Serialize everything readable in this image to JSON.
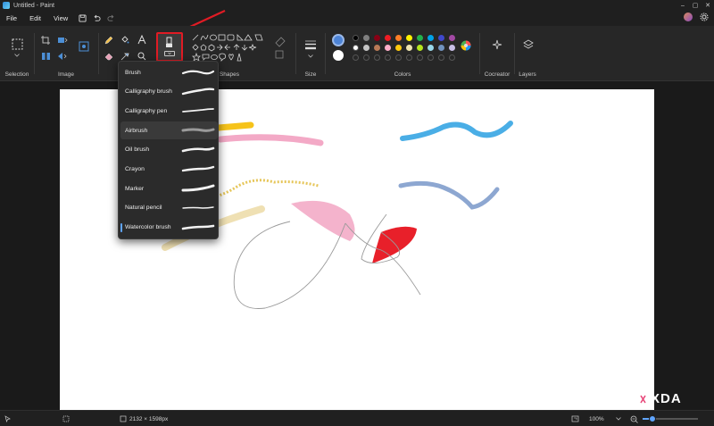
{
  "window": {
    "title": "Untitled - Paint",
    "controls": [
      "–",
      "▢",
      "✕"
    ]
  },
  "menu": {
    "items": [
      "File",
      "Edit",
      "View"
    ]
  },
  "ribbon": {
    "groups": {
      "selection": "Selection",
      "image": "Image",
      "shapes": "Shapes",
      "size": "Size",
      "colors": "Colors",
      "cocreator": "Cocreator",
      "layers": "Layers"
    },
    "primary_color": "#4c83d6",
    "secondary_color": "#ffffff",
    "palette_row1": [
      "#000000",
      "#7f7f7f",
      "#880015",
      "#ed1c24",
      "#ff7f27",
      "#fff200",
      "#22b14c",
      "#00a2e8",
      "#3f48cc",
      "#a349a4"
    ],
    "palette_row2": [
      "#ffffff",
      "#c3c3c3",
      "#b97a57",
      "#ffaec9",
      "#ffc90e",
      "#efe4b0",
      "#b5e61d",
      "#99d9ea",
      "#7092be",
      "#c8bfe7"
    ]
  },
  "brush_menu": {
    "items": [
      {
        "label": "Brush"
      },
      {
        "label": "Calligraphy brush"
      },
      {
        "label": "Calligraphy pen"
      },
      {
        "label": "Airbrush"
      },
      {
        "label": "Oil brush"
      },
      {
        "label": "Crayon"
      },
      {
        "label": "Marker"
      },
      {
        "label": "Natural pencil"
      },
      {
        "label": "Watercolor brush"
      }
    ],
    "hovered": "Airbrush",
    "selected": "Watercolor brush"
  },
  "status": {
    "canvas_size": "2132 × 1598px",
    "zoom": "100%"
  },
  "watermark": "XDA"
}
